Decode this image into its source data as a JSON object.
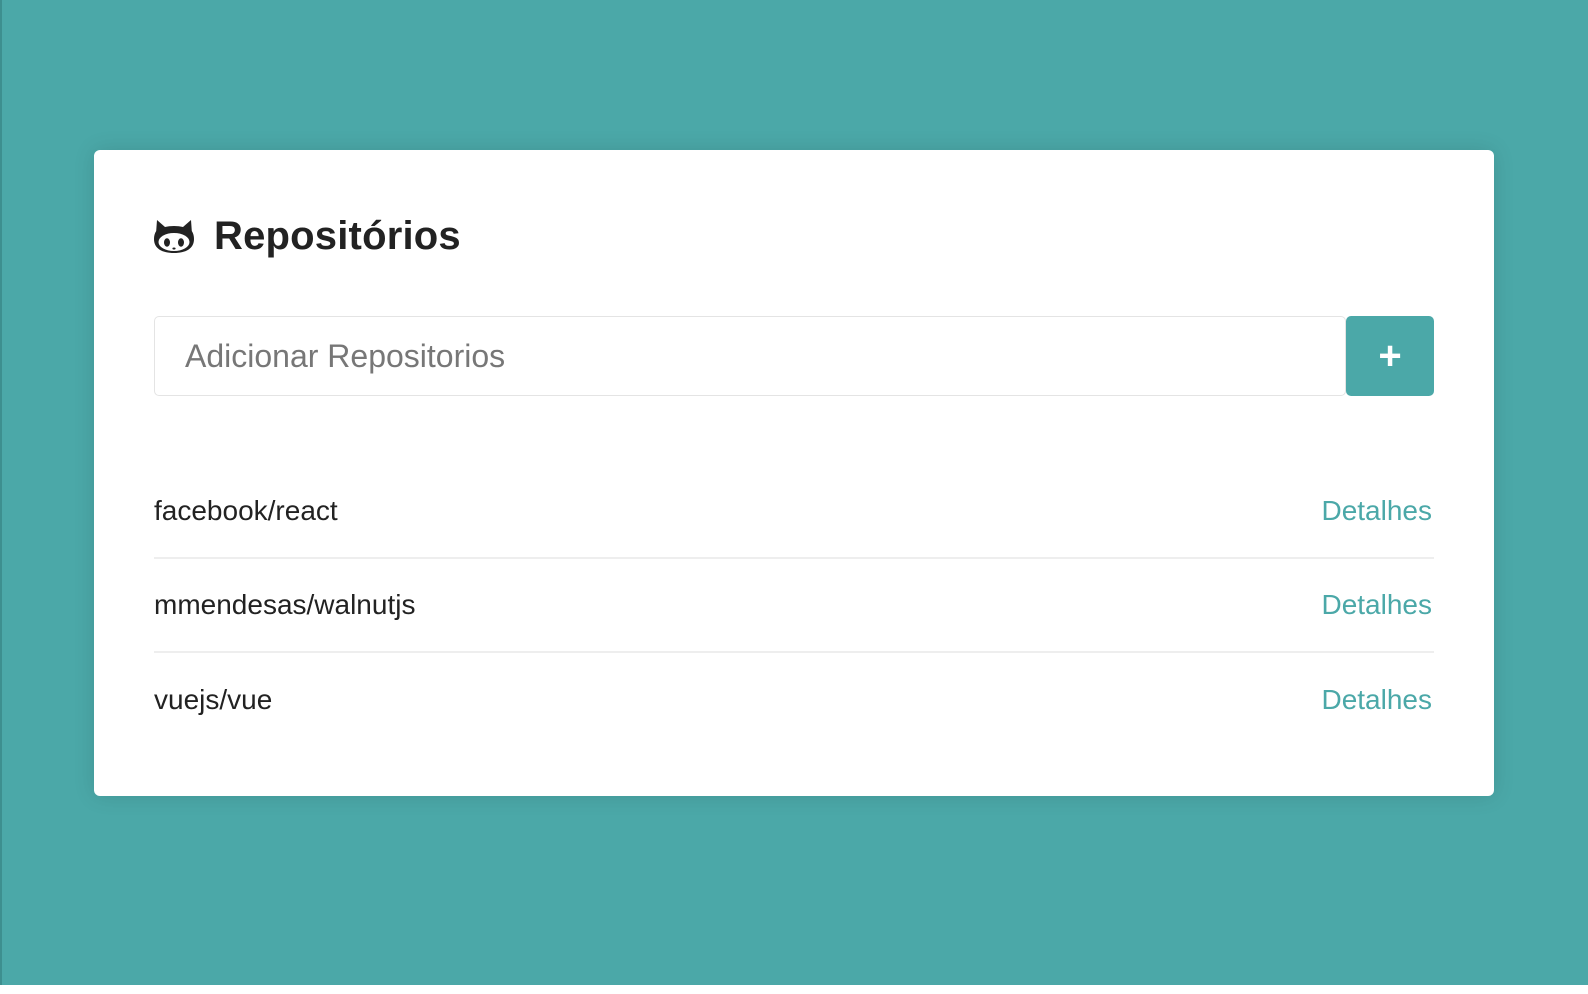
{
  "colors": {
    "background": "#4ba8a8",
    "card": "#ffffff",
    "accent": "#4ba8a8",
    "text": "#222222"
  },
  "header": {
    "icon": "github-icon",
    "title": "Repositórios"
  },
  "form": {
    "input_placeholder": "Adicionar Repositorios",
    "input_value": "",
    "add_button_label": "+"
  },
  "repositories": [
    {
      "name": "facebook/react",
      "link_label": "Detalhes"
    },
    {
      "name": "mmendesas/walnutjs",
      "link_label": "Detalhes"
    },
    {
      "name": "vuejs/vue",
      "link_label": "Detalhes"
    }
  ]
}
